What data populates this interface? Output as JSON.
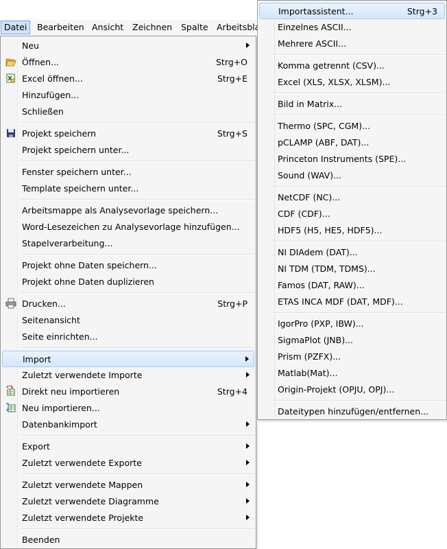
{
  "menubar": {
    "items": [
      "Datei",
      "Bearbeiten",
      "Ansicht",
      "Zeichnen",
      "Spalte",
      "Arbeitsbla"
    ]
  },
  "file_menu": {
    "groups": [
      [
        {
          "label": "Neu",
          "submenu": true
        },
        {
          "label": "Öffnen...",
          "shortcut": "Strg+O",
          "icon": "open-folder-icon"
        },
        {
          "label": "Excel öffnen...",
          "shortcut": "Strg+E",
          "icon": "excel-open-icon"
        },
        {
          "label": "Hinzufügen..."
        },
        {
          "label": "Schließen"
        }
      ],
      [
        {
          "label": "Projekt speichern",
          "shortcut": "Strg+S",
          "icon": "save-disk-icon"
        },
        {
          "label": "Projekt speichern unter..."
        }
      ],
      [
        {
          "label": "Fenster speichern unter..."
        },
        {
          "label": "Template speichern unter..."
        }
      ],
      [
        {
          "label": "Arbeitsmappe als Analysevorlage speichern..."
        },
        {
          "label": "Word-Lesezeichen zu Analysevorlage hinzufügen..."
        },
        {
          "label": "Stapelverarbeitung..."
        }
      ],
      [
        {
          "label": "Projekt ohne Daten speichern..."
        },
        {
          "label": "Projekt ohne Daten duplizieren"
        }
      ],
      [
        {
          "label": "Drucken...",
          "shortcut": "Strg+P",
          "icon": "printer-icon"
        },
        {
          "label": "Seitenansicht"
        },
        {
          "label": "Seite einrichten..."
        }
      ],
      [
        {
          "label": "Import",
          "submenu": true,
          "highlighted": true
        },
        {
          "label": "Zuletzt verwendete Importe",
          "submenu": true
        },
        {
          "label": "Direkt neu importieren",
          "shortcut": "Strg+4",
          "icon": "reimport-direct-icon"
        },
        {
          "label": "Neu importieren...",
          "icon": "reimport-icon"
        },
        {
          "label": "Datenbankimport",
          "submenu": true
        }
      ],
      [
        {
          "label": "Export",
          "submenu": true
        },
        {
          "label": "Zuletzt verwendete Exporte",
          "submenu": true
        }
      ],
      [
        {
          "label": "Zuletzt verwendete Mappen",
          "submenu": true
        },
        {
          "label": "Zuletzt verwendete Diagramme",
          "submenu": true
        },
        {
          "label": "Zuletzt verwendete Projekte",
          "submenu": true
        }
      ],
      [
        {
          "label": "Beenden"
        }
      ]
    ]
  },
  "import_submenu": {
    "groups": [
      [
        {
          "label": "Importassistent...",
          "shortcut": "Strg+3",
          "highlighted": true
        },
        {
          "label": "Einzelnes ASCII..."
        },
        {
          "label": "Mehrere ASCII..."
        }
      ],
      [
        {
          "label": "Komma getrennt (CSV)..."
        },
        {
          "label": "Excel (XLS, XLSX, XLSM)..."
        }
      ],
      [
        {
          "label": "Bild in Matrix..."
        }
      ],
      [
        {
          "label": "Thermo (SPC, CGM)..."
        },
        {
          "label": "pCLAMP (ABF, DAT)..."
        },
        {
          "label": "Princeton Instruments (SPE)..."
        },
        {
          "label": "Sound (WAV)..."
        }
      ],
      [
        {
          "label": "NetCDF (NC)..."
        },
        {
          "label": "CDF (CDF)..."
        },
        {
          "label": "HDF5 (H5, HE5, HDF5)..."
        }
      ],
      [
        {
          "label": "NI DIAdem (DAT)..."
        },
        {
          "label": "NI TDM (TDM, TDMS)..."
        },
        {
          "label": "Famos (DAT, RAW)..."
        },
        {
          "label": "ETAS INCA MDF (DAT, MDF)..."
        }
      ],
      [
        {
          "label": "IgorPro (PXP, IBW)..."
        },
        {
          "label": "SigmaPlot (JNB)..."
        },
        {
          "label": "Prism (PZFX)..."
        },
        {
          "label": "Matlab(Mat)..."
        },
        {
          "label": "Origin-Projekt (OPJU, OPJ)..."
        }
      ],
      [
        {
          "label": "Dateitypen hinzufügen/entfernen..."
        }
      ]
    ]
  }
}
